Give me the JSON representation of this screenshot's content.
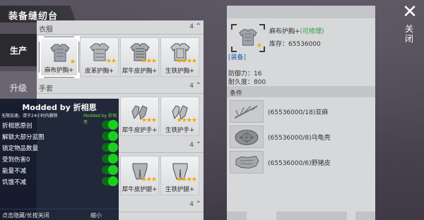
{
  "window": {
    "title": "装备缝纫台",
    "close_label": "关闭"
  },
  "tabs": [
    {
      "label": "生产",
      "active": true
    },
    {
      "label": "升级",
      "active": false
    }
  ],
  "categories": [
    {
      "name": "衣服",
      "count": "4",
      "items": [
        {
          "name": "麻布护胸+",
          "stars": "★",
          "selected": true
        },
        {
          "name": "皮革护胸+",
          "stars": "★★"
        },
        {
          "name": "犀牛皮护胸+",
          "stars": "★★★"
        },
        {
          "name": "生铁护胸+",
          "stars": "★★★★"
        }
      ]
    },
    {
      "name": "手套",
      "count": "4",
      "items": [
        {
          "name": "犀牛皮护手+",
          "stars": "★★★"
        },
        {
          "name": "生铁护手+",
          "stars": "★★★★"
        }
      ]
    },
    {
      "name": "",
      "count": "4",
      "items": [
        {
          "name": "犀牛皮护腿+",
          "stars": "★★★"
        },
        {
          "name": "生铁护腿+",
          "stars": "★★★★"
        }
      ]
    },
    {
      "name": "",
      "count": "4",
      "items": []
    }
  ],
  "mod_menu": {
    "title": "Modded by 折相思",
    "subtitle_left": "无限加速。请于24小时内删除",
    "subtitle_right": "Modded by 折相思",
    "options": [
      {
        "label": "折相思原创",
        "enabled": true
      },
      {
        "label": "解锁大部分蓝图",
        "enabled": true
      },
      {
        "label": "锁定物品数量",
        "enabled": true
      },
      {
        "label": "受到伤害0",
        "enabled": true
      },
      {
        "label": "能量不减",
        "enabled": true
      },
      {
        "label": "饥饿不减",
        "enabled": true
      }
    ],
    "footer_left": "点击隐藏/长按关闭",
    "footer_right": "缩小"
  },
  "detail": {
    "name": "麻布护胸+",
    "repairable": "(可修理)",
    "stars": "★",
    "stock": "库存：65536000",
    "type": "[装备]",
    "defense": "防御力：16",
    "durability": "耐久度：800",
    "conditions_label": "条件",
    "materials": [
      {
        "text": "(65536000/18)亚麻",
        "icon": "flax-icon"
      },
      {
        "text": "(65536000/8)乌龟壳",
        "icon": "turtle-shell-icon"
      },
      {
        "text": "(65536000/6)野猪皮",
        "icon": "boar-hide-icon"
      }
    ]
  },
  "colors": {
    "accent_gold": "#f2a600",
    "repair_green": "#2a9d3a",
    "type_blue": "#1e63b0",
    "toggle_on": "#19d11c"
  }
}
